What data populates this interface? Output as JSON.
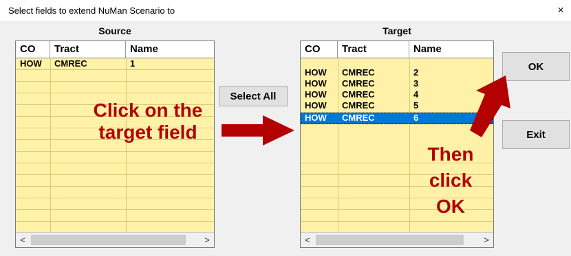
{
  "window": {
    "title": "Select fields to extend NuMan Scenario to",
    "close_label": "×"
  },
  "source": {
    "label": "Source",
    "columns": [
      "CO",
      "Tract",
      "Name"
    ],
    "rows": [
      {
        "co": "HOW",
        "tract": "CMREC",
        "name": "1"
      }
    ]
  },
  "target": {
    "label": "Target",
    "columns": [
      "CO",
      "Tract",
      "Name"
    ],
    "rows": [
      {
        "co": "HOW",
        "tract": "CMREC",
        "name": "2"
      },
      {
        "co": "HOW",
        "tract": "CMREC",
        "name": "3"
      },
      {
        "co": "HOW",
        "tract": "CMREC",
        "name": "4"
      },
      {
        "co": "HOW",
        "tract": "CMREC",
        "name": "5"
      },
      {
        "co": "HOW",
        "tract": "CMREC",
        "name": "6"
      }
    ],
    "selected_index": 4
  },
  "buttons": {
    "select_all": "Select All",
    "ok": "OK",
    "exit": "Exit"
  },
  "scrollbar": {
    "left_arrow": "<",
    "right_arrow": ">"
  },
  "annotations": {
    "click_target_line1": "Click on the",
    "click_target_line2": "target field",
    "then_line1": "Then",
    "then_line2": "click",
    "then_line3": "OK",
    "color": "#b30000"
  },
  "colors": {
    "list_bg": "#fff2a8",
    "selection": "#0078d7"
  }
}
